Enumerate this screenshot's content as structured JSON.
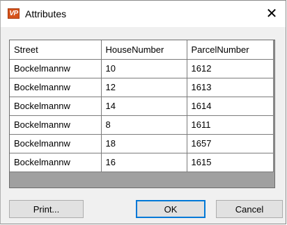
{
  "window": {
    "title": "Attributes",
    "app_icon_text": "VP",
    "close_glyph": "✕"
  },
  "table": {
    "columns": [
      "Street",
      "HouseNumber",
      "ParcelNumber"
    ],
    "rows": [
      [
        "Bockelmannw",
        "10",
        "1612"
      ],
      [
        "Bockelmannw",
        "12",
        "1613"
      ],
      [
        "Bockelmannw",
        "14",
        "1614"
      ],
      [
        "Bockelmannw",
        "8",
        "1611"
      ],
      [
        "Bockelmannw",
        "18",
        "1657"
      ],
      [
        "Bockelmannw",
        "16",
        "1615"
      ]
    ]
  },
  "buttons": {
    "print": "Print...",
    "ok": "OK",
    "cancel": "Cancel"
  },
  "icons": {
    "app": "app-logo-icon",
    "close": "close-icon"
  },
  "colors": {
    "app_icon": "#d6531b",
    "default_button_border": "#0078d7",
    "grid_background": "#a0a0a0"
  }
}
